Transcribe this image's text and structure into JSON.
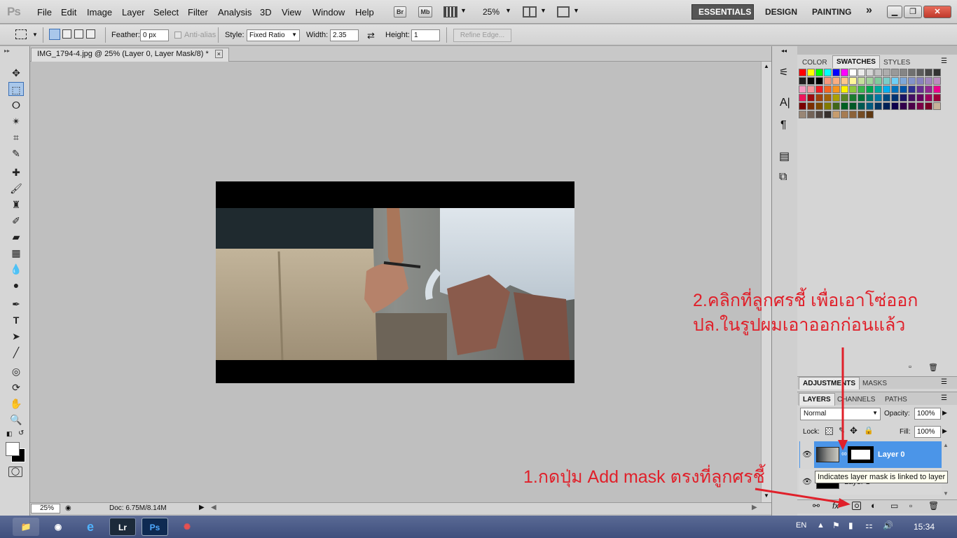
{
  "app": {
    "logo": "Ps"
  },
  "menu": [
    "File",
    "Edit",
    "Image",
    "Layer",
    "Select",
    "Filter",
    "Analysis",
    "3D",
    "View",
    "Window",
    "Help"
  ],
  "toolbar": {
    "bridge": "Br",
    "minibridge": "Mb",
    "zoom": "25%"
  },
  "workspaces": [
    "ESSENTIALS",
    "DESIGN",
    "PAINTING"
  ],
  "workspace_more": "»",
  "options": {
    "feather_label": "Feather:",
    "feather_value": "0 px",
    "antialias_label": "Anti-alias",
    "style_label": "Style:",
    "style_value": "Fixed Ratio",
    "width_label": "Width:",
    "width_value": "2.35",
    "height_label": "Height:",
    "height_value": "1",
    "refine_edge": "Refine Edge..."
  },
  "document": {
    "tab_title": "IMG_1794-4.jpg @ 25% (Layer 0, Layer Mask/8) *",
    "tab_close": "×"
  },
  "status": {
    "zoom": "25%",
    "doc": "Doc: 6.75M/8.14M"
  },
  "panels": {
    "top_tabs": [
      "COLOR",
      "SWATCHES",
      "STYLES"
    ],
    "adj_tabs": [
      "ADJUSTMENTS",
      "MASKS"
    ],
    "layer_tabs": [
      "LAYERS",
      "CHANNELS",
      "PATHS"
    ],
    "blend_mode": "Normal",
    "opacity_label": "Opacity:",
    "opacity_value": "100%",
    "lock_label": "Lock:",
    "fill_label": "Fill:",
    "fill_value": "100%",
    "layer0_name": "Layer 0",
    "layer1_name": "Layer 1"
  },
  "tooltip": "Indicates layer mask is linked to layer",
  "annotations": {
    "step2_line1": "2.คลิกที่ลูกศรชี้ เพื่อเอาโซ่ออก",
    "step2_line2": "ปล.ในรูปผมเอาออกก่อนแล้ว",
    "step1": "1.กดปุ่ม Add mask ตรงที่ลูกศรชี้"
  },
  "taskbar": {
    "lang": "EN",
    "time": "15:34",
    "lr": "Lr",
    "ps": "Ps"
  },
  "swatch_colors": [
    "#ff0000",
    "#ffff00",
    "#00ff00",
    "#00ffff",
    "#0000ff",
    "#ff00ff",
    "#ffffff",
    "#ebebeb",
    "#d6d6d6",
    "#c2c2c2",
    "#adadad",
    "#999999",
    "#858585",
    "#707070",
    "#5c5c5c",
    "#474747",
    "#333333",
    "#1f1f1f",
    "#0a0a0a",
    "#000000",
    "#f7977a",
    "#f9ad81",
    "#fdc68a",
    "#fff79a",
    "#c4df9b",
    "#a2d39c",
    "#82ca9d",
    "#7bcdc8",
    "#6ecff6",
    "#7ea7d8",
    "#8493ca",
    "#8882be",
    "#a187be",
    "#bc8dbf",
    "#f49ac2",
    "#f6989d",
    "#ed1c24",
    "#f26522",
    "#f7941d",
    "#fff200",
    "#8dc73f",
    "#39b54a",
    "#00a651",
    "#00a99d",
    "#00aeef",
    "#0072bc",
    "#0054a6",
    "#2e3192",
    "#662d91",
    "#92278f",
    "#ec008c",
    "#ed145b",
    "#9e0b0f",
    "#a0410d",
    "#a36209",
    "#aba000",
    "#598527",
    "#1a7b30",
    "#007236",
    "#00746b",
    "#0076a3",
    "#004a80",
    "#003471",
    "#1b1464",
    "#440e62",
    "#630460",
    "#9e005d",
    "#9e0039",
    "#790000",
    "#7b2e00",
    "#7d4900",
    "#827b00",
    "#406618",
    "#005e20",
    "#005826",
    "#005952",
    "#005b7f",
    "#003663",
    "#002157",
    "#0d004c",
    "#32004b",
    "#4b0049",
    "#7b0046",
    "#7a0026",
    "#c7b299",
    "#998675",
    "#736357",
    "#534741",
    "#37302d",
    "#c69c6d",
    "#a67c52",
    "#8c6239",
    "#754c24",
    "#603913"
  ]
}
